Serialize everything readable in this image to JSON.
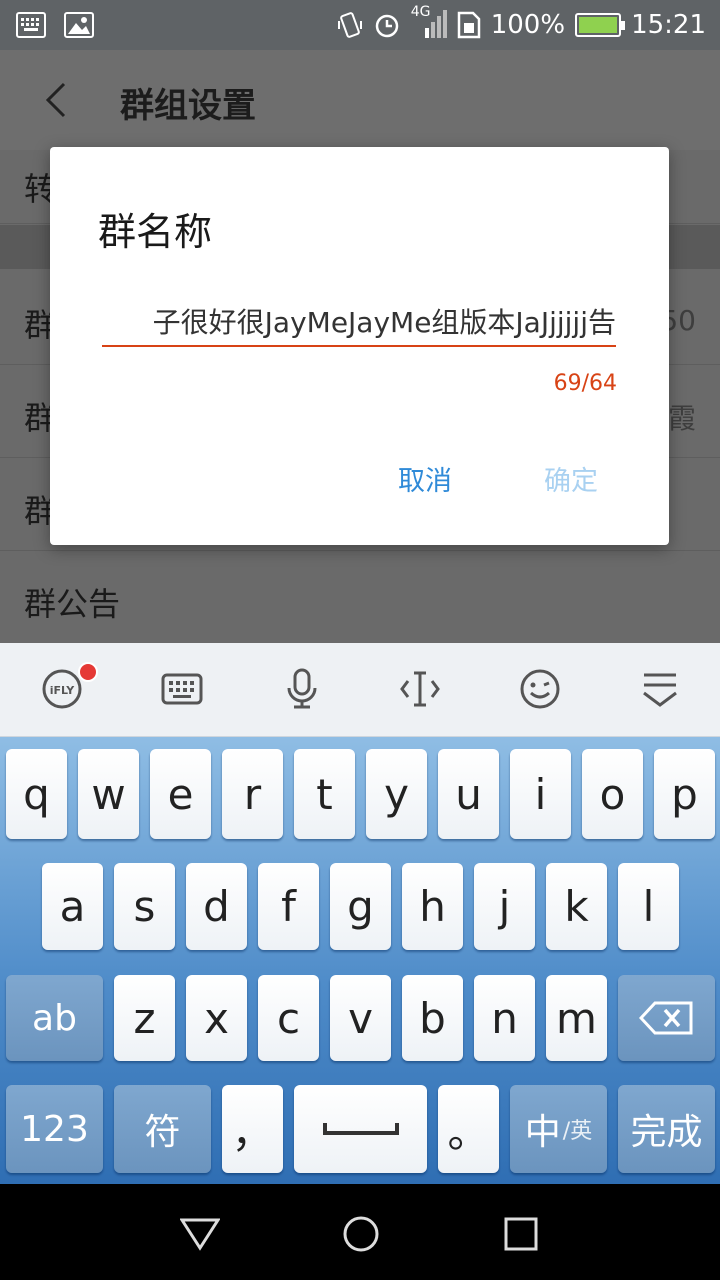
{
  "status_bar": {
    "network": "4G",
    "battery": "100%",
    "time": "15:21",
    "icons": [
      "keyboard-icon",
      "image-icon",
      "vibrate-icon",
      "alarm-icon",
      "signal-icon",
      "sim-icon",
      "battery-icon"
    ]
  },
  "header": {
    "title": "群组设置"
  },
  "settings": {
    "rows": [
      {
        "label": "转",
        "value": ""
      },
      {
        "label": "群",
        "value": "50"
      },
      {
        "label": "群",
        "value": "霞"
      },
      {
        "label": "群",
        "value": ""
      },
      {
        "label": "群公告",
        "value": ""
      }
    ]
  },
  "dialog": {
    "title": "群名称",
    "input_value": "子很好很JayMeJayMe组版本JaJjjjjj告",
    "counter": "69/64",
    "cancel_label": "取消",
    "ok_label": "确定"
  },
  "keyboard_toolbar": {
    "icons": [
      "ifly-icon",
      "keyboard-icon",
      "microphone-icon",
      "text-cursor-icon",
      "emoji-icon",
      "hide-keyboard-icon"
    ]
  },
  "keyboard": {
    "row1": [
      "q",
      "w",
      "e",
      "r",
      "t",
      "y",
      "u",
      "i",
      "o",
      "p"
    ],
    "row2": [
      "a",
      "s",
      "d",
      "f",
      "g",
      "h",
      "j",
      "k",
      "l"
    ],
    "row3": [
      "z",
      "x",
      "c",
      "v",
      "b",
      "n",
      "m"
    ],
    "shift_label": "ab",
    "num_label": "123",
    "symbol_label": "符",
    "comma_label": "，",
    "period_label": "。",
    "lang_main": "中",
    "lang_sub": "/英",
    "done_label": "完成"
  },
  "colors": {
    "accent_orange": "#d84315",
    "button_blue": "#2f8ad8",
    "button_disabled": "#a9d1f1",
    "battery_green": "#8fd14f"
  }
}
